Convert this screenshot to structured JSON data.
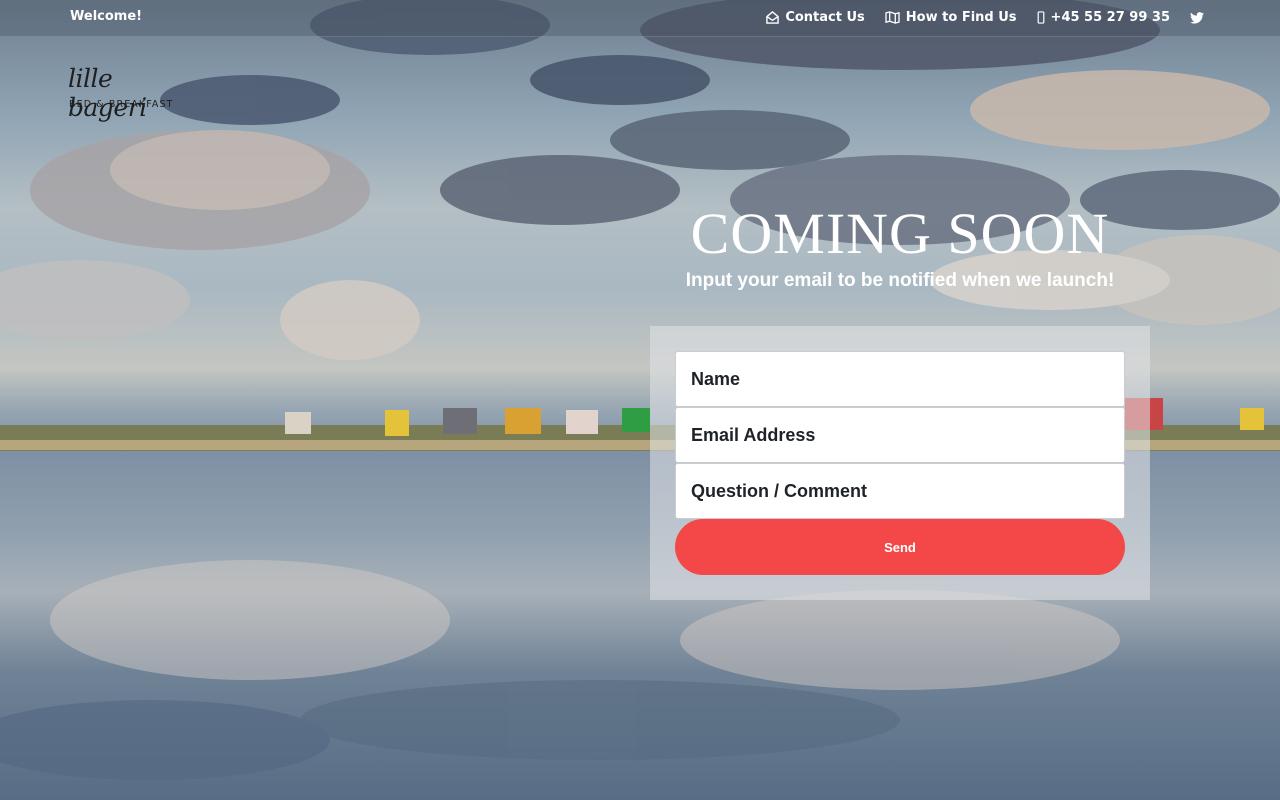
{
  "topbar": {
    "welcome": "Welcome!",
    "nav": {
      "contact": "Contact Us",
      "find": "How to Find Us",
      "phone": "+45 55 27 99 35"
    },
    "icons": [
      "envelope-open-icon",
      "map-icon",
      "phone-icon",
      "twitter-icon"
    ]
  },
  "logo": {
    "script": "lille bageri",
    "sub": "BED & BREAKFAST"
  },
  "hero": {
    "title": "COMING SOON",
    "subtitle": "Input your email to be notified when we launch!"
  },
  "form": {
    "name_placeholder": "Name",
    "email_placeholder": "Email Address",
    "comment_placeholder": "Question / Comment",
    "send_label": "Send"
  },
  "colors": {
    "accent": "#f44848",
    "text": "#ffffff"
  }
}
